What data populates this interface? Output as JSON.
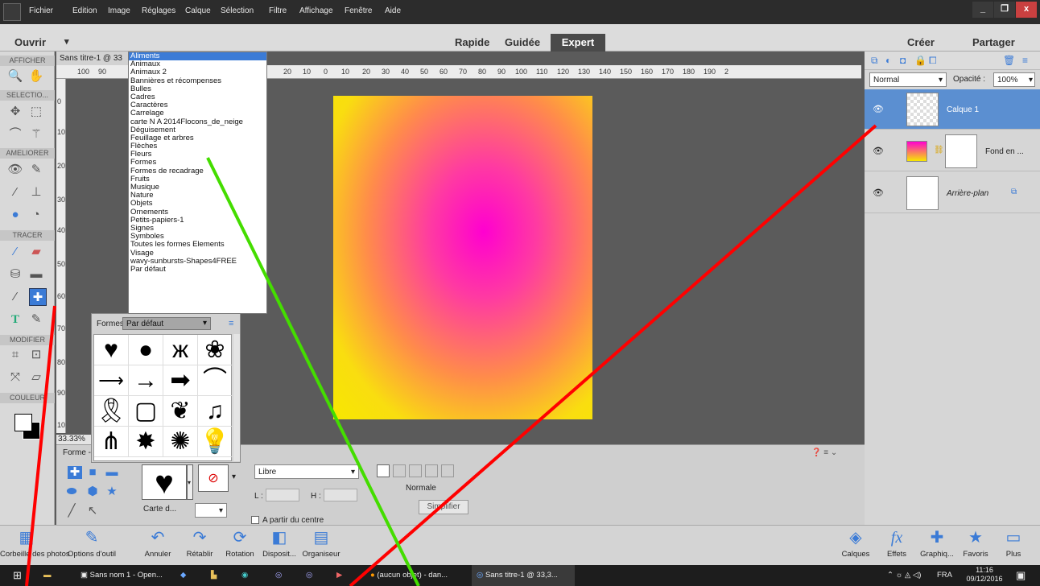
{
  "menubar": {
    "items": [
      "Fichier",
      "Edition",
      "Image",
      "Réglages",
      "Calque",
      "Sélection",
      "Filtre",
      "Affichage",
      "Fenêtre",
      "Aide"
    ],
    "window_buttons": [
      "_",
      "❐",
      "x"
    ]
  },
  "modebar": {
    "ouvrir": "Ouvrir",
    "tabs": [
      "Rapide",
      "Guidée",
      "Expert"
    ],
    "active_tab": "Expert",
    "creer": "Créer",
    "partager": "Partager"
  },
  "toolbar": {
    "sections": [
      "AFFICHER",
      "SELECTIO...",
      "AMELIORER",
      "TRACER",
      "MODIFIER",
      "COULEUR"
    ]
  },
  "document": {
    "tab": "Sans titre-1 @ 33",
    "ruler_ticks": [
      "100",
      "90",
      "20",
      "10",
      "0",
      "10",
      "20",
      "30",
      "40",
      "50",
      "60",
      "70",
      "80",
      "90",
      "100",
      "110",
      "120",
      "130",
      "140",
      "150",
      "160",
      "170",
      "180",
      "190",
      "2"
    ],
    "ruler_v_ticks": [
      "0",
      "10",
      "20",
      "30",
      "40",
      "50",
      "60",
      "70",
      "80",
      "90",
      "10"
    ],
    "zoom": "33.33%"
  },
  "dropdown": {
    "items": [
      "Aliments",
      "Animaux",
      "Animaux 2",
      "Bannières et récompenses",
      "Bulles",
      "Cadres",
      "Caractères",
      "Carrelage",
      "carte N A 2014Flocons_de_neige",
      "Déguisement",
      "Feuillage et arbres",
      "Flèches",
      "Fleurs",
      "Formes",
      "Formes de recadrage",
      "Fruits",
      "Musique",
      "Nature",
      "Objets",
      "Ornements",
      "Petits-papiers-1",
      "Signes",
      "Symboles",
      "Toutes les formes Elements",
      "Visage",
      "wavy-sunbursts-Shapes4FREE",
      "Par défaut"
    ],
    "selected": "Aliments"
  },
  "shapes_panel": {
    "label": "Formes",
    "selected": "Par défaut",
    "shapes": [
      "heart",
      "speech-bubble",
      "butterfly",
      "paw",
      "thin-arrow",
      "arrow",
      "bold-arrow",
      "banner",
      "ribbon",
      "frame",
      "cherries",
      "music-note",
      "grass",
      "star-burst",
      "snowflake",
      "lightbulb"
    ]
  },
  "options": {
    "forme_label": "Forme -",
    "carte_label": "Carte d...",
    "libre": "Libre",
    "l_label": "L :",
    "h_label": "H :",
    "normale": "Normale",
    "simplifier": "Simplifier",
    "a_partir_du_centre": "A partir du centre"
  },
  "layers": {
    "blend_mode": "Normal",
    "opacity_label": "Opacité :",
    "opacity": "100%",
    "items": [
      {
        "name": "Calque 1",
        "selected": true
      },
      {
        "name": "Fond en ...",
        "selected": false
      },
      {
        "name": "Arrière-plan",
        "selected": false
      }
    ]
  },
  "bottombar": {
    "left": [
      "Corbeille des photos",
      "Options d'outil",
      "Annuler",
      "Rétablir",
      "Rotation",
      "Disposit...",
      "Organiseur"
    ],
    "right": [
      "Calques",
      "Effets",
      "Graphiq...",
      "Favoris",
      "Plus"
    ]
  },
  "taskbar": {
    "items": [
      "Sans nom 1 - Open...",
      "(aucun objet) - dan...",
      "Sans titre-1 @ 33,3..."
    ],
    "lang": "FRA",
    "time": "11:16",
    "date": "09/12/2016"
  },
  "colors": {
    "accent": "#3b7bd6",
    "annotation_red": "#ff0000",
    "annotation_green": "#44dd00",
    "canvas_center": "#ff00d0",
    "canvas_edge": "#f7e800"
  }
}
